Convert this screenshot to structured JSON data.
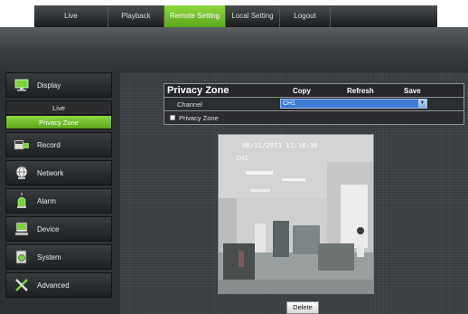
{
  "nav": {
    "tabs": [
      {
        "label": "Live"
      },
      {
        "label": "Playback"
      },
      {
        "label": "Remote Setting"
      },
      {
        "label": "Local Setting"
      },
      {
        "label": "Logout"
      }
    ],
    "active_tab": "Remote Setting"
  },
  "sidebar": {
    "items": [
      {
        "label": "Display",
        "icon": "monitor-icon"
      },
      {
        "label": "Record",
        "icon": "film-icon"
      },
      {
        "label": "Network",
        "icon": "globe-icon"
      },
      {
        "label": "Alarm",
        "icon": "siren-icon"
      },
      {
        "label": "Device",
        "icon": "hdd-icon"
      },
      {
        "label": "System",
        "icon": "system-icon"
      },
      {
        "label": "Advanced",
        "icon": "tools-icon"
      }
    ],
    "display_sub": [
      {
        "label": "Live"
      },
      {
        "label": "Privacy Zone"
      }
    ],
    "active_sub": "Privacy Zone"
  },
  "main": {
    "title": "Privacy Zone",
    "copy_label": "Copy",
    "refresh_label": "Refresh",
    "save_label": "Save",
    "channel_label": "Channel",
    "channel_value": "CH1",
    "privacy_zone_label": "Privacy Zone",
    "privacy_zone_checked": false,
    "camera": {
      "timestamp": "08/11/2011 11:16:30",
      "channel_overlay": "CH1"
    },
    "delete_label": "Delete"
  },
  "colors": {
    "accent_green": "#6ebf2a",
    "select_blue": "#3f7ad6"
  }
}
